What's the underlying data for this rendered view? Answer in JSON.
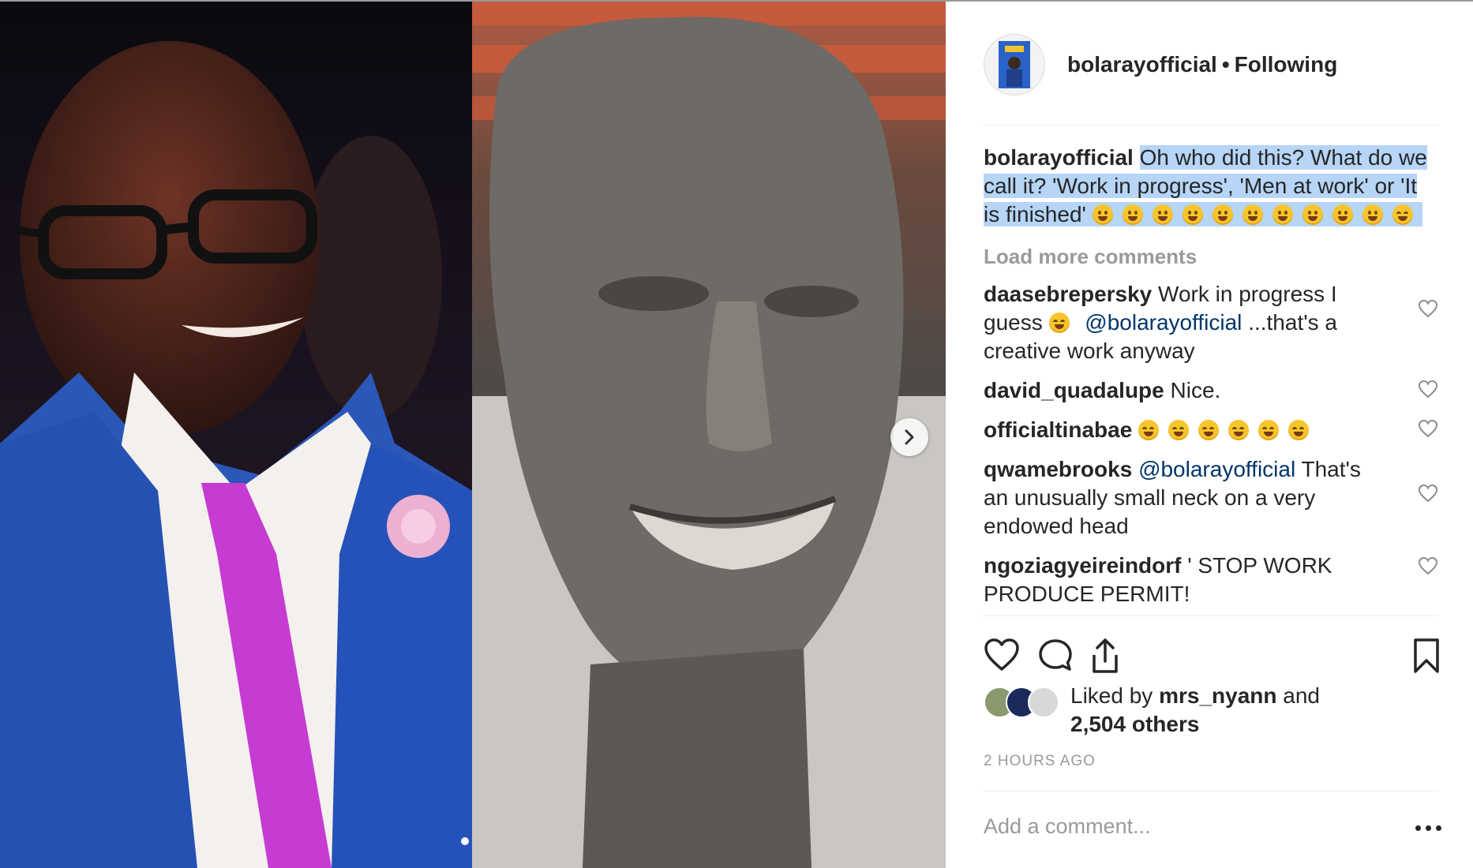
{
  "post": {
    "username": "bolarayofficial",
    "separator": "•",
    "follow_status": "Following",
    "caption_user": "bolarayofficial",
    "caption_text": "Oh who did this? What do we call it? 'Work in progress', 'Men at work' or 'It is finished'",
    "caption_emojis": [
      "grin",
      "grin",
      "grin",
      "grin",
      "grin",
      "grin",
      "grin",
      "grin",
      "grin",
      "grin",
      "joy"
    ],
    "load_more": "Load more comments",
    "comments": [
      {
        "user": "daasebrepersky",
        "text_before": "Work in progress I guess",
        "emoji": "joy",
        "mention": "@bolarayofficial",
        "text_after": "...that's a creative work anyway"
      },
      {
        "user": "david_quadalupe",
        "text": "Nice."
      },
      {
        "user": "officialtinabae",
        "emojis": [
          "joy",
          "joy",
          "joy",
          "joy",
          "joy",
          "joy"
        ]
      },
      {
        "user": "qwamebrooks",
        "mention": "@bolarayofficial",
        "text": "That's an unusually small neck on a very endowed head"
      },
      {
        "user": "ngoziagyeireindorf",
        "text": "' STOP WORK PRODUCE PERMIT!"
      }
    ],
    "liked_by_prefix": "Liked by",
    "liked_by_user": "mrs_nyann",
    "liked_by_and": "and",
    "liked_by_others": "2,504 others",
    "timestamp": "2 HOURS AGO",
    "add_comment_placeholder": "Add a comment..."
  },
  "icons": {
    "like": "heart-icon",
    "comment": "comment-icon",
    "share": "share-icon",
    "save": "bookmark-icon",
    "next": "chevron-right-icon",
    "more": "more-options-icon"
  },
  "colors": {
    "text": "#262626",
    "muted": "#9a9a9a",
    "mention": "#003569",
    "selection": "#b6d5f7",
    "divider": "#efefef"
  }
}
